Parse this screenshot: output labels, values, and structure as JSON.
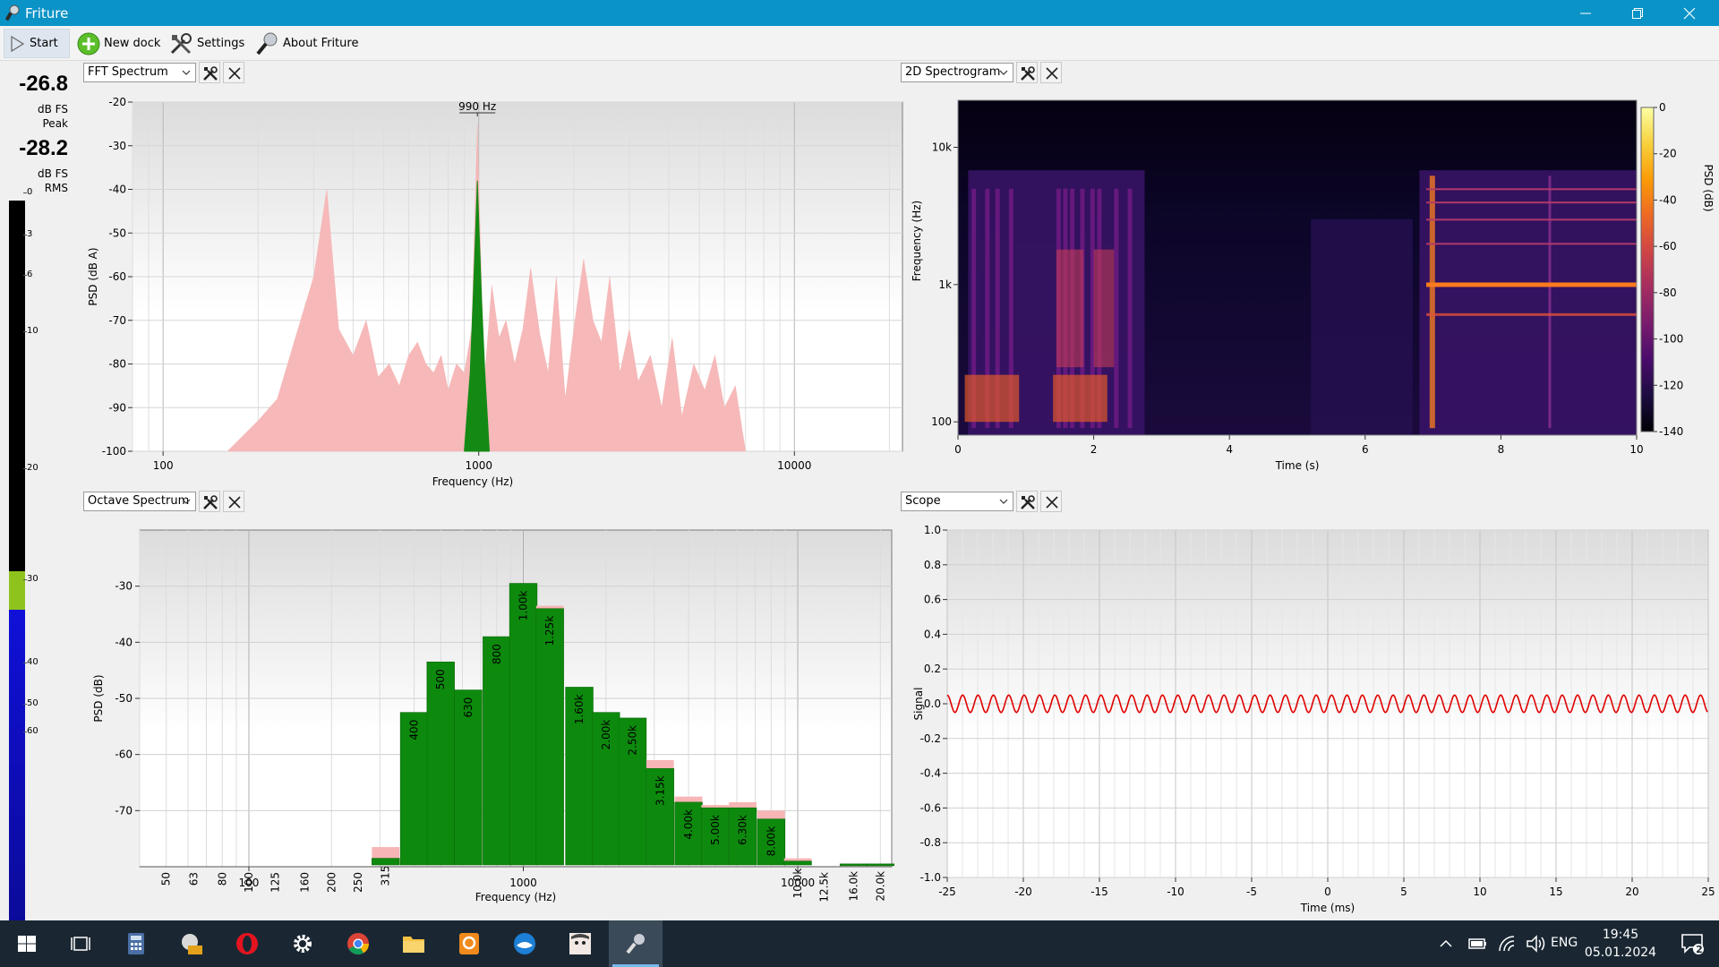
{
  "window": {
    "title": "Friture"
  },
  "toolbar": {
    "start_label": "Start",
    "new_dock_label": "New dock",
    "settings_label": "Settings",
    "about_label": "About Friture"
  },
  "levels": {
    "peak_value": "-26.8",
    "peak_unit": "dB FS",
    "peak_label": "Peak",
    "rms_value": "-28.2",
    "rms_unit": "dB FS",
    "rms_label": "RMS",
    "scale": [
      "0",
      "3",
      "6",
      "10",
      "20",
      "30",
      "40",
      "50",
      "60"
    ],
    "peak_fraction": 0.52,
    "rms_fraction": 0.47,
    "colors": {
      "green": "#8ec31e",
      "blue": "#1010d8",
      "black": "#000000"
    }
  },
  "docks": {
    "fft": {
      "selector": "FFT Spectrum"
    },
    "spectrogram": {
      "selector": "2D Spectrogram"
    },
    "octave": {
      "selector": "Octave Spectrum"
    },
    "scope": {
      "selector": "Scope"
    }
  },
  "chart_data": [
    {
      "id": "fft",
      "type": "area",
      "xlabel": "Frequency (Hz)",
      "ylabel": "PSD (dB A)",
      "xscale": "log",
      "xlim": [
        80,
        22000
      ],
      "ylim": [
        -100,
        -20
      ],
      "xticks": [
        "100",
        "1000",
        "10000"
      ],
      "xtick_values": [
        100,
        1000,
        10000
      ],
      "yticks": [
        "-20",
        "-30",
        "-40",
        "-50",
        "-60",
        "-70",
        "-80",
        "-90",
        "-100"
      ],
      "annotation": "990 Hz",
      "peak_hz": 990,
      "series": [
        {
          "color": "#f6b8b8",
          "x": [
            160,
            200,
            230,
            260,
            300,
            330,
            360,
            400,
            440,
            480,
            520,
            560,
            600,
            640,
            680,
            720,
            760,
            800,
            850,
            900,
            950,
            990,
            1040,
            1100,
            1160,
            1220,
            1300,
            1380,
            1460,
            1560,
            1660,
            1760,
            1880,
            2000,
            2150,
            2300,
            2450,
            2600,
            2800,
            3000,
            3200,
            3500,
            3800,
            4100,
            4400,
            4800,
            5200,
            5600,
            6000,
            6500,
            7000
          ],
          "values": [
            -100,
            -93,
            -88,
            -75,
            -60,
            -40,
            -72,
            -78,
            -70,
            -83,
            -80,
            -85,
            -78,
            -75,
            -80,
            -82,
            -78,
            -86,
            -80,
            -82,
            -72,
            -25,
            -85,
            -62,
            -74,
            -70,
            -80,
            -72,
            -58,
            -73,
            -82,
            -60,
            -88,
            -72,
            -56,
            -70,
            -75,
            -60,
            -82,
            -72,
            -84,
            -78,
            -90,
            -74,
            -92,
            -80,
            -86,
            -78,
            -90,
            -85,
            -100
          ]
        },
        {
          "color": "#148a14",
          "x": [
            900,
            940,
            960,
            975,
            990,
            1005,
            1020,
            1045,
            1080
          ],
          "values": [
            -100,
            -82,
            -65,
            -52,
            -38,
            -52,
            -65,
            -82,
            -100
          ]
        }
      ]
    },
    {
      "id": "spectrogram",
      "type": "heatmap",
      "xlabel": "Time (s)",
      "ylabel": "Frequency (Hz)",
      "colorbar_label": "PSD (dB)",
      "xlim": [
        0,
        10
      ],
      "xticks": [
        "0",
        "2",
        "4",
        "6",
        "8",
        "10"
      ],
      "yticks": [
        "100",
        "1k",
        "10k"
      ],
      "colorbar_ticks": [
        "0",
        "-20",
        "-40",
        "-60",
        "-80",
        "-100",
        "-120",
        "-140"
      ],
      "colorbar_range": [
        -140,
        0
      ],
      "colormap": [
        "#000004",
        "#1b0c41",
        "#4a0c6b",
        "#781c6d",
        "#a52c60",
        "#cf4446",
        "#ed6925",
        "#fb9b06",
        "#f7d13d",
        "#fcffa4"
      ]
    },
    {
      "id": "octave",
      "type": "bar",
      "xlabel": "Frequency (Hz)",
      "ylabel": "PSD (dB)",
      "xscale": "log",
      "ylim": [
        -80,
        -20
      ],
      "xticks": [
        "100",
        "1000",
        "10000"
      ],
      "xtick_values": [
        100,
        1000,
        10000
      ],
      "yticks": [
        "-30",
        "-40",
        "-50",
        "-60",
        "-70"
      ],
      "ytick_values": [
        -30,
        -40,
        -50,
        -60,
        -70
      ],
      "categories": [
        "50",
        "63",
        "80",
        "100",
        "125",
        "160",
        "200",
        "250",
        "315",
        "400",
        "500",
        "630",
        "800",
        "1.00k",
        "1.25k",
        "1.60k",
        "2.00k",
        "2.50k",
        "3.15k",
        "4.00k",
        "5.00k",
        "6.30k",
        "8.00k",
        "10.0k",
        "12.5k",
        "16.0k",
        "20.0k"
      ],
      "centers": [
        50,
        63,
        80,
        100,
        125,
        160,
        200,
        250,
        315,
        400,
        500,
        630,
        800,
        1000,
        1250,
        1600,
        2000,
        2500,
        3150,
        4000,
        5000,
        6300,
        8000,
        10000,
        12500,
        16000,
        20000
      ],
      "values": [
        -80,
        -80,
        -80,
        -80,
        -80,
        -80,
        -80,
        -80,
        -78.5,
        -52.5,
        -43.5,
        -48.5,
        -39,
        -29.5,
        -34,
        -48,
        -52.5,
        -53.5,
        -62.5,
        -68.5,
        -69.5,
        -69.5,
        -71.5,
        -79,
        -80,
        -79.5,
        -79.5
      ],
      "peak_values": [
        -80,
        -80,
        -80,
        -80,
        -80,
        -80,
        -80,
        -80,
        -76.5,
        -52.5,
        -43.5,
        -48.5,
        -39,
        -29.5,
        -33.5,
        -48,
        -52.5,
        -53.5,
        -61,
        -67.5,
        -69,
        -68.5,
        -70,
        -78.5,
        -80,
        -79.5,
        -79.5
      ],
      "colors": {
        "bar": "#0d8a0d",
        "peak": "#f7b5b5"
      }
    },
    {
      "id": "scope",
      "type": "line",
      "xlabel": "Time (ms)",
      "ylabel": "Signal",
      "xlim": [
        -25,
        25
      ],
      "ylim": [
        -1,
        1
      ],
      "xticks": [
        "-25",
        "-20",
        "-15",
        "-10",
        "-5",
        "0",
        "5",
        "10",
        "15",
        "20",
        "25"
      ],
      "xtick_values": [
        -25,
        -20,
        -15,
        -10,
        -5,
        0,
        5,
        10,
        15,
        20,
        25
      ],
      "yticks": [
        "1.0",
        "0.8",
        "0.6",
        "0.4",
        "0.2",
        "0.0",
        "-0.2",
        "-0.4",
        "-0.6",
        "-0.8",
        "-1.0"
      ],
      "ytick_values": [
        1.0,
        0.8,
        0.6,
        0.4,
        0.2,
        0.0,
        -0.2,
        -0.4,
        -0.6,
        -0.8,
        -1.0
      ],
      "frequency_hz": 990,
      "amplitude": 0.05,
      "color": "#e00000"
    }
  ],
  "taskbar": {
    "apps": [
      "start-windows",
      "task-view",
      "calculator",
      "sdb",
      "opera",
      "settings",
      "chrome",
      "file-explorer",
      "pdf-app",
      "thunderbird",
      "anime-app",
      "friture"
    ],
    "tray_language": "ENG",
    "clock_time": "19:45",
    "clock_date": "05.01.2024",
    "notifications": "2"
  }
}
